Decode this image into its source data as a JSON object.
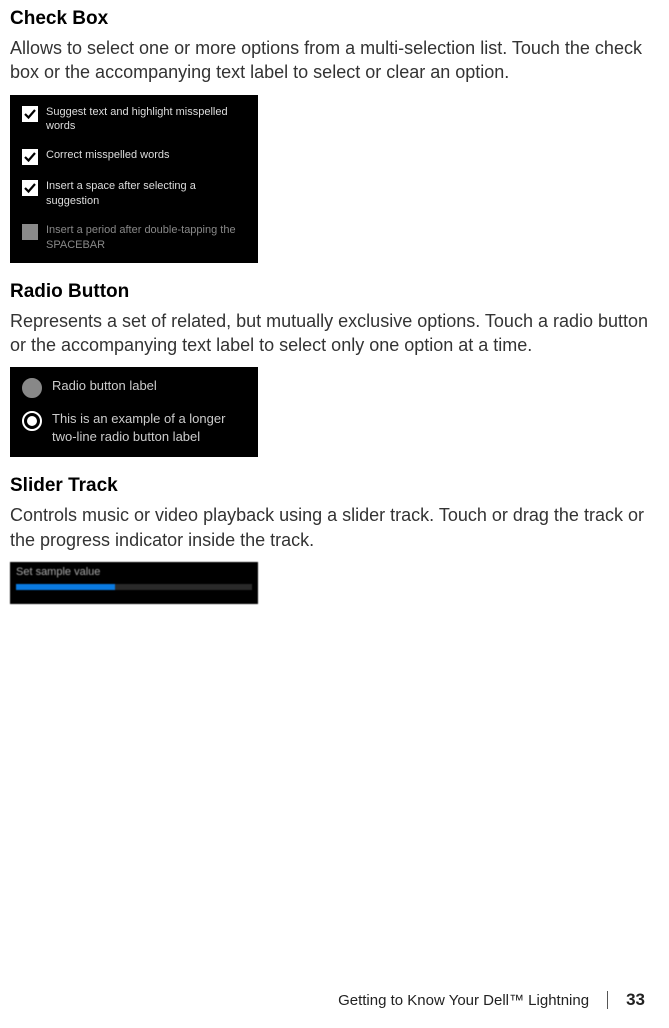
{
  "sections": {
    "checkbox": {
      "heading": "Check Box",
      "body": "Allows to select one or more options from a multi-selection list. Touch the check box or the accompanying text label to select or clear an option.",
      "items": [
        {
          "label": "Suggest text and highlight misspelled words",
          "checked": true
        },
        {
          "label": "Correct misspelled words",
          "checked": true
        },
        {
          "label": "Insert a space after selecting a suggestion",
          "checked": true
        },
        {
          "label": "Insert a period after double-tapping the SPACEBAR",
          "checked": false
        }
      ]
    },
    "radio": {
      "heading": "Radio Button",
      "body": "Represents a set of related, but mutually exclusive options. Touch a radio button or the accompanying text label to select only one option at a time.",
      "items": [
        {
          "label": "Radio button label",
          "selected": false
        },
        {
          "label": "This is an example of a longer two-line radio button label",
          "selected": true
        }
      ]
    },
    "slider": {
      "heading": "Slider Track",
      "body": "Controls music or video playback using a slider track. Touch or drag the track or the progress indicator inside the track.",
      "title": "Set sample value",
      "percent": 42
    }
  },
  "footer": {
    "chapter": "Getting to Know Your Dell™ Lightning",
    "page": "33"
  }
}
